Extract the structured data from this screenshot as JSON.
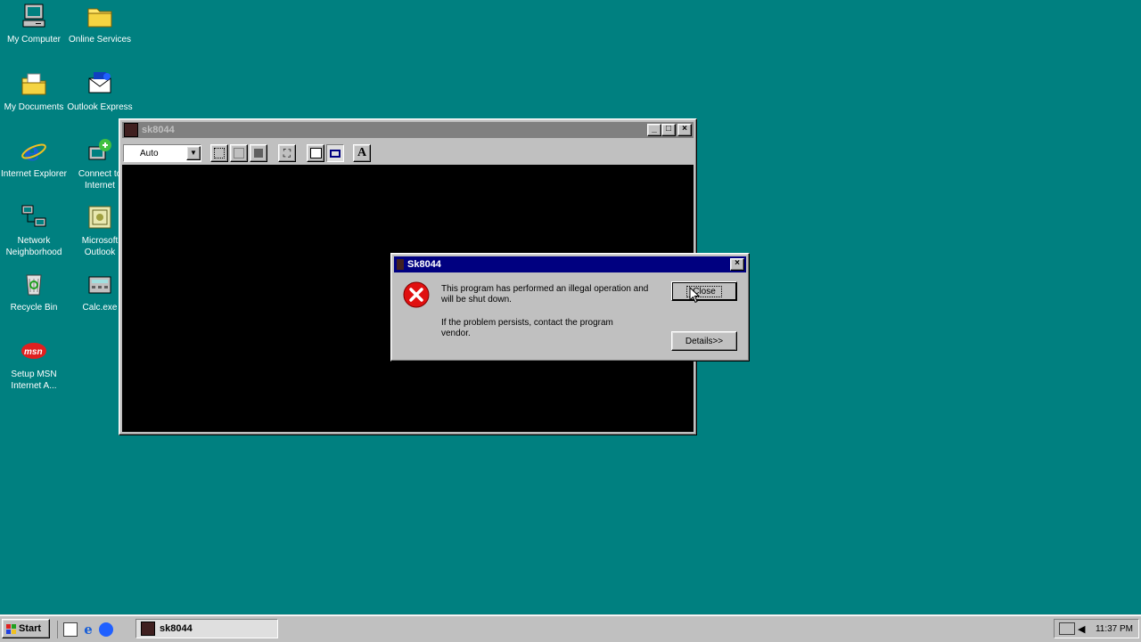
{
  "desktop": {
    "icons": [
      {
        "label": "My Computer"
      },
      {
        "label": "Online Services"
      },
      {
        "label": "My Documents"
      },
      {
        "label": "Outlook Express"
      },
      {
        "label": "Internet Explorer"
      },
      {
        "label": "Connect to Internet"
      },
      {
        "label": "Network Neighborhood"
      },
      {
        "label": "Microsoft Outlook"
      },
      {
        "label": "Recycle Bin"
      },
      {
        "label": "Calc.exe"
      },
      {
        "label": "Setup MSN Internet A..."
      }
    ]
  },
  "main_window": {
    "title": "sk8044",
    "font_select": {
      "value": "Auto"
    },
    "toolbar": {
      "font_button": "A"
    }
  },
  "dialog": {
    "title": "Sk8044",
    "message1": "This program has performed an illegal operation and will be shut down.",
    "message2": "If the problem persists, contact the program vendor.",
    "close_label": "Close",
    "details_label": "Details>>"
  },
  "taskbar": {
    "start_label": "Start",
    "task_label": "sk8044",
    "clock": "11:37 PM"
  },
  "colors": {
    "desktop": "#008080",
    "title_active": "#000080",
    "title_inactive": "#808080",
    "error_red": "#e01010"
  }
}
